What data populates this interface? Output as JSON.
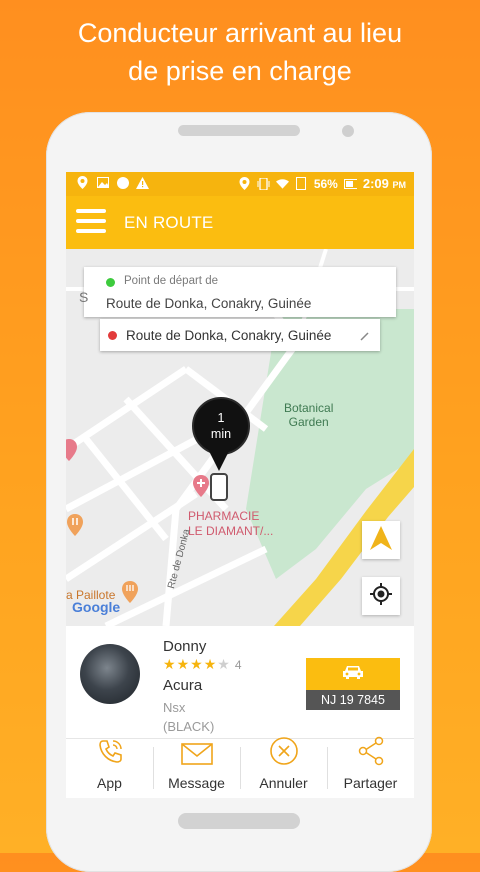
{
  "headline": {
    "line1": "Conducteur arrivant au lieu",
    "line2": "de prise en charge"
  },
  "status_bar": {
    "battery": "56%",
    "time": "2:09",
    "ampm": "PM"
  },
  "app_bar": {
    "title": "EN ROUTE"
  },
  "pickup": {
    "label": "Point de départ de",
    "value": "Route de Donka, Conakry, Guinée",
    "dot_color": "#3dcb3d"
  },
  "destination": {
    "value": "Route de Donka, Conakry, Guinée",
    "dot_color": "#e23b3b"
  },
  "map": {
    "eta_value": "1",
    "eta_unit": "min",
    "park_line1": "Botanical",
    "park_line2": "Garden",
    "pharmacy_line1": "PHARMACIE",
    "pharmacy_line2": "LE DIAMANT/...",
    "place_label": "a Paillote",
    "street_label": "Rte de Donka",
    "edge_letter": "S",
    "google_logo": "Google"
  },
  "driver": {
    "name": "Donny",
    "rating": "4",
    "rating_value": 4,
    "rating_max": 5,
    "make": "Acura",
    "model": "Nsx",
    "color": "(BLACK)",
    "plate": "NJ 19 7845",
    "accent_color": "#fbbd10"
  },
  "bottom_nav": [
    {
      "label": "App",
      "icon": "phone-icon"
    },
    {
      "label": "Message",
      "icon": "envelope-icon"
    },
    {
      "label": "Annuler",
      "icon": "cancel-icon"
    },
    {
      "label": "Partager",
      "icon": "share-icon"
    }
  ],
  "colors": {
    "accent": "#fbbd10",
    "status_bar": "#f6b40e",
    "icon_orange": "#f0a51b"
  }
}
